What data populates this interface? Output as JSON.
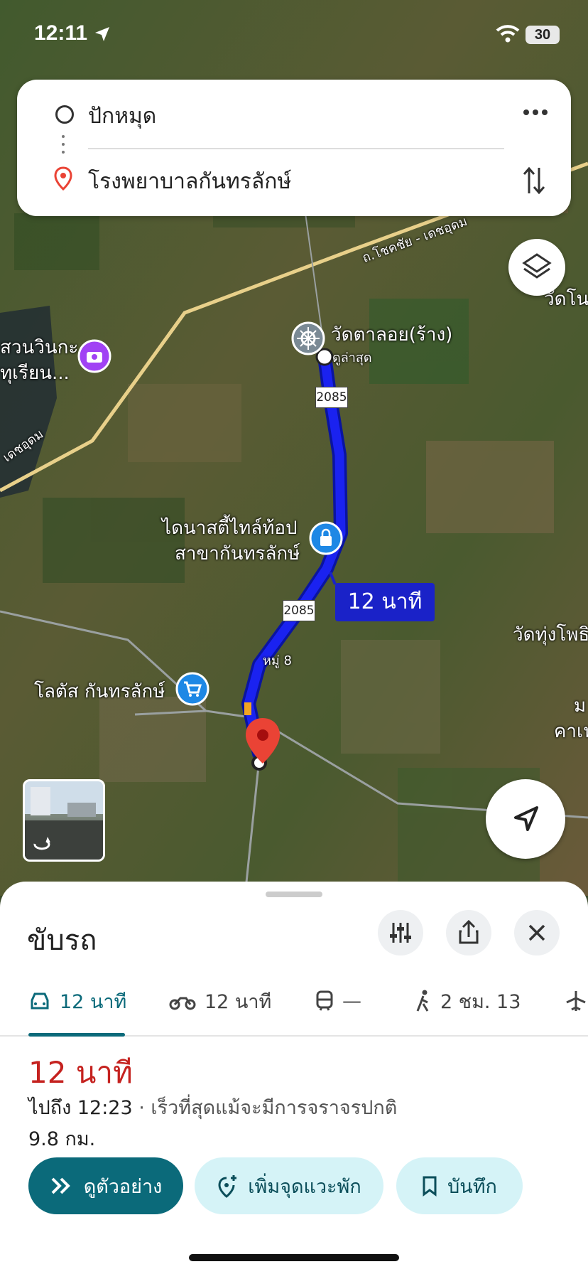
{
  "status_bar": {
    "time": "12:11",
    "battery": "30"
  },
  "route": {
    "origin": "ปักหมุด",
    "destination": "โรงพยาบาลกันทรลักษ์"
  },
  "map": {
    "labels": {
      "wat_talloi": "วัดตาลอย(ร้าง)",
      "latest": "ดูล่าสุด",
      "dynasty_line1": "ไดนาสตี้ไทล์ท้อป",
      "dynasty_line2": "สาขากันทรลักษ์",
      "lotus": "โลตัส กันทรลักษ์",
      "moo8": "หมู่ 8",
      "wat_thung": "วัดทุ่งโพธิ",
      "wat_right": "วัดโน",
      "left_line1": "สวนวินกะ",
      "left_line2": "ทุเรียน...",
      "road_top": "ถ.โชคชัย - เดชอุดม",
      "road_left": "เดชอุดม",
      "right_m": "ม",
      "right_ka": "คาเฟ"
    },
    "route_shield_1": "2085",
    "route_shield_2": "2085",
    "eta_bubble": "12 นาที"
  },
  "sheet": {
    "title": "ขับรถ",
    "tabs": [
      {
        "label": "12 นาที",
        "icon": "car-icon",
        "active": true
      },
      {
        "label": "12 นาที",
        "icon": "motorcycle-icon"
      },
      {
        "label": "—",
        "icon": "transit-icon"
      },
      {
        "label": "2 ชม. 13",
        "icon": "walk-icon"
      }
    ],
    "result": {
      "duration": "12 นาที",
      "arrive": "ไปถึง 12:23",
      "arrive_note": " · เร็วที่สุดแม้จะมีการจราจรปกติ",
      "distance": "9.8 กม."
    },
    "buttons": {
      "preview": "ดูตัวอย่าง",
      "add_stop": "เพิ่มจุดแวะพัก",
      "save": "บันทึก"
    }
  },
  "colors": {
    "route": "#1a22f0",
    "accent": "#0b6a7a",
    "eta_red": "#c5221f"
  }
}
